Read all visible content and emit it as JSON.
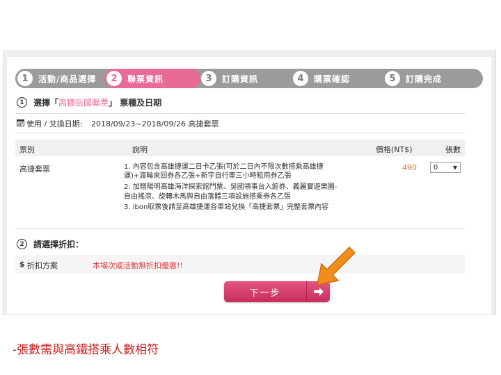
{
  "steps": [
    {
      "num": "1",
      "label": "活動/商品選擇"
    },
    {
      "num": "2",
      "label": "聯票資訊"
    },
    {
      "num": "3",
      "label": "訂購資訊"
    },
    {
      "num": "4",
      "label": "購票確認"
    },
    {
      "num": "5",
      "label": "訂購完成"
    }
  ],
  "section1": {
    "num": "1",
    "prefix": "選擇「",
    "name": "高捷岳國聯票",
    "suffix": "」 票種及日期",
    "date_label": "使用 / 兌換日期:",
    "date_value": "2018/09/23~2018/09/26  高捷套票"
  },
  "table": {
    "headers": {
      "type": "票別",
      "desc": "說明",
      "price": "價格(NT$)",
      "qty": "張數"
    },
    "row": {
      "type": "高捷套票",
      "desc_lines": [
        "1. 內容包含高雄捷運二日卡乙張(可於二日內不限次數搭乘高雄捷",
        "   運)+渡輪來回券各乙張+新宇自行車三小時租用券乙張",
        "2. 加贈陽明高雄海洋探索館門票、吳國領事台入館券、義麗實遊樂園-",
        "   自由搖滾、旋轉木馬與自由落體三項設施搭乘券各乙張",
        "3. ibon取票後請至高雄捷運各車站兌換「高捷套票」完整套票內容"
      ],
      "price": "490",
      "qty": "0"
    }
  },
  "section2": {
    "num": "2",
    "title": "請選擇折扣：",
    "discount_label": "折扣方案",
    "discount_value": "本場次或活動無折扣優惠!!"
  },
  "next_button": "下一步",
  "footer_note": "-張數需與高鐵搭乘人數相符",
  "colors": {
    "accent": "#e86a97",
    "step_grey": "#9b9b9b",
    "note_red": "#cc1d1d",
    "arrow_orange": "#f28c1a"
  },
  "icons": {
    "calendar": "calendar-icon",
    "dollar": "dollar-icon",
    "next": "arrow-right-icon",
    "pointer": "orange-arrow-icon"
  }
}
